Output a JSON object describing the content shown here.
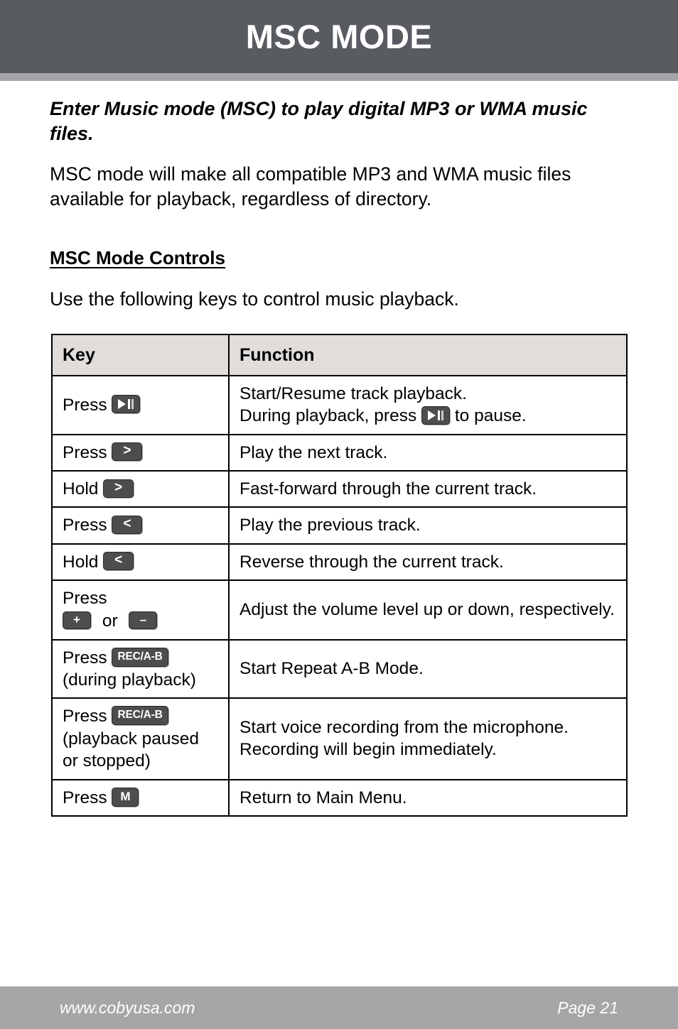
{
  "header": {
    "title": "MSC MODE",
    "bar_color": "#585c61",
    "accent_color": "#a6a6a8"
  },
  "intro": {
    "bold_text": "Enter Music mode (MSC) to play digital MP3 or WMA music files.",
    "body_text": "MSC mode will make all compatible MP3 and WMA music files available for playback, regardless of directory."
  },
  "section": {
    "heading": "MSC Mode Controls",
    "subtext": "Use the following keys to control music playback."
  },
  "table": {
    "columns": [
      "Key",
      "Function"
    ],
    "header_bg": "#e0dddb",
    "rows": [
      {
        "key_prefix": "Press",
        "key_icon": "play-pause-button-icon",
        "key_suffix": "",
        "function_lines": [
          "Start/Resume track playback.",
          "During playback, press  to pause."
        ],
        "function_line1": "Start/Resume track playback.",
        "function_line2_before": "During playback, press",
        "function_line2_after": "to pause.",
        "function_line2_icon": "play-pause-button-icon"
      },
      {
        "key_prefix": "Press",
        "key_icon": "next-track-button-icon",
        "key_icon_glyph": ">",
        "function": "Play the next track."
      },
      {
        "key_prefix": "Hold",
        "key_icon": "next-track-button-icon",
        "key_icon_glyph": ">",
        "function": "Fast-forward through the current track."
      },
      {
        "key_prefix": "Press",
        "key_icon": "previous-track-button-icon",
        "key_icon_glyph": "<",
        "function": "Play the previous track."
      },
      {
        "key_prefix": "Hold",
        "key_icon": "previous-track-button-icon",
        "key_icon_glyph": "<",
        "function": "Reverse through the current track."
      },
      {
        "key_prefix": "Press",
        "key_icon_glyph_plus": "+",
        "key_or_word": "or",
        "key_icon_glyph_minus": "–",
        "function": "Adjust the volume level up or down, respectively."
      },
      {
        "key_prefix": "Press",
        "key_icon_label": "REC/A-B",
        "key_note": "(during playback)",
        "function": "Start Repeat A-B Mode."
      },
      {
        "key_prefix": "Press",
        "key_icon_label": "REC/A-B",
        "key_note_line1": "(playback paused",
        "key_note_line2": "or stopped)",
        "function_line1": "Start voice recording from the microphone.",
        "function_line2": "Recording will begin immediately."
      },
      {
        "key_prefix": "Press",
        "key_icon_label": "M",
        "function": "Return to Main Menu."
      }
    ]
  },
  "footer": {
    "url": "www.cobyusa.com",
    "page": "Page 21",
    "bar_color": "#a6a6a8"
  }
}
